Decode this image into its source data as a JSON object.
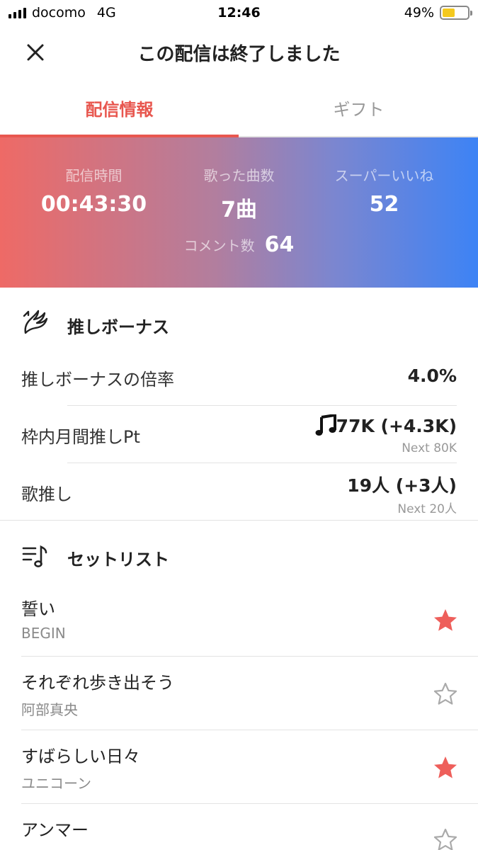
{
  "status_bar": {
    "carrier": "docomo",
    "network": "4G",
    "time": "12:46",
    "battery": "49%",
    "battery_level": 0.49
  },
  "header": {
    "title": "この配信は終了しました",
    "close_icon": "close-icon"
  },
  "tabs": [
    {
      "label": "配信情報",
      "active": true
    },
    {
      "label": "ギフト",
      "active": false
    }
  ],
  "stats": {
    "duration_label": "配信時間",
    "duration_value": "00:43:30",
    "songs_label": "歌った曲数",
    "songs_value": "7曲",
    "superlike_label": "スーパーいいね",
    "superlike_value": "52",
    "comments_label": "コメント数",
    "comments_value": "64",
    "gradient_colors": [
      "#ee6a66",
      "#3d83f5"
    ]
  },
  "bonus": {
    "title": "推しボーナス",
    "icon": "wing-icon",
    "rows": [
      {
        "label": "推しボーナスの倍率",
        "value": "4.0%"
      },
      {
        "label": "枠内月間推しPt",
        "value": "77K (+4.3K)",
        "value_icon": "music-note-icon",
        "sub": "Next 80K"
      },
      {
        "label": "歌推し",
        "value": "19人 (+3人)",
        "sub": "Next 20人"
      }
    ]
  },
  "setlist": {
    "title": "セットリスト",
    "icon": "setlist-icon",
    "songs": [
      {
        "title": "誓い",
        "artist": "BEGIN",
        "favorited": true
      },
      {
        "title": "それぞれ歩き出そう",
        "artist": "阿部真央",
        "favorited": false
      },
      {
        "title": "すばらしい日々",
        "artist": "ユニコーン",
        "favorited": true
      },
      {
        "title": "アンマー",
        "artist": "",
        "favorited": false
      }
    ]
  },
  "accent_color": "#e8574f"
}
